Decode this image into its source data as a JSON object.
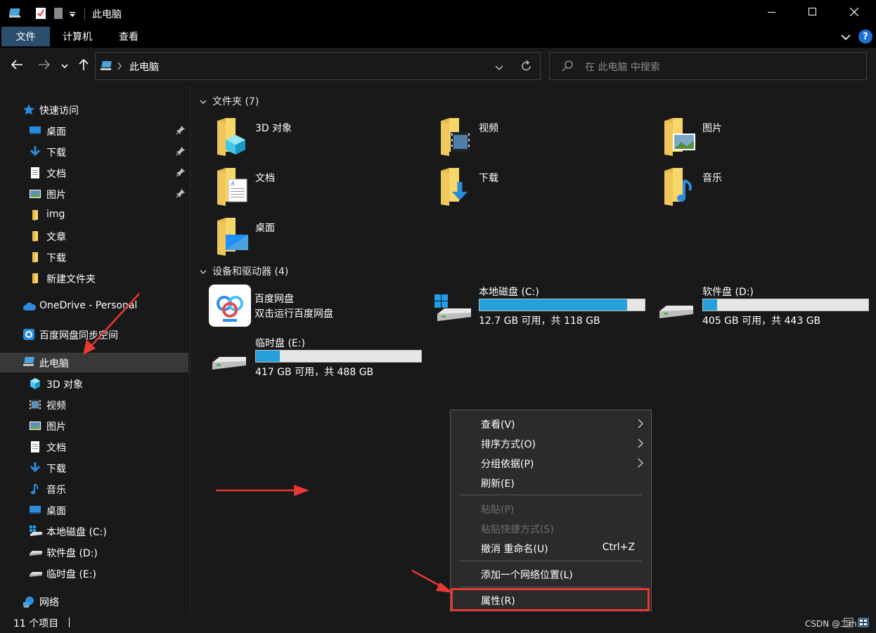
{
  "window": {
    "title": "此电脑",
    "minimize_icon": "minimize-icon",
    "maximize_icon": "maximize-icon",
    "close_icon": "close-icon"
  },
  "ribbon": {
    "tabs": [
      {
        "label": "文件",
        "active": true
      },
      {
        "label": "计算机",
        "active": false
      },
      {
        "label": "查看",
        "active": false
      }
    ],
    "help_icon": "?"
  },
  "address": {
    "path": "此电脑",
    "search_placeholder": "在 此电脑 中搜索"
  },
  "nav": {
    "quick_access": "快速访问",
    "pinned": [
      {
        "label": "桌面",
        "icon": "desktop-icon",
        "pinned": true
      },
      {
        "label": "下载",
        "icon": "download-icon",
        "pinned": true
      },
      {
        "label": "文档",
        "icon": "document-icon",
        "pinned": true
      },
      {
        "label": "图片",
        "icon": "picture-icon",
        "pinned": true
      },
      {
        "label": "img",
        "icon": "folder-icon",
        "pinned": false
      },
      {
        "label": "文章",
        "icon": "folder-icon",
        "pinned": false
      },
      {
        "label": "下载",
        "icon": "folder-icon",
        "pinned": false
      },
      {
        "label": "新建文件夹",
        "icon": "folder-icon",
        "pinned": false
      }
    ],
    "onedrive": "OneDrive - Personal",
    "baidu_sync": "百度网盘同步空间",
    "this_pc": "此电脑",
    "this_pc_children": [
      {
        "label": "3D 对象",
        "icon": "3d-objects-icon"
      },
      {
        "label": "视频",
        "icon": "video-icon"
      },
      {
        "label": "图片",
        "icon": "picture-icon"
      },
      {
        "label": "文档",
        "icon": "document-icon"
      },
      {
        "label": "下载",
        "icon": "download-icon"
      },
      {
        "label": "音乐",
        "icon": "music-icon"
      },
      {
        "label": "桌面",
        "icon": "desktop-icon"
      },
      {
        "label": "本地磁盘 (C:)",
        "icon": "windows-drive-icon"
      },
      {
        "label": "软件盘 (D:)",
        "icon": "drive-icon"
      },
      {
        "label": "临时盘 (E:)",
        "icon": "drive-icon"
      }
    ],
    "network": "网络"
  },
  "content": {
    "folders_header": "文件夹 (7)",
    "folders": [
      {
        "label": "3D 对象",
        "icon": "3d-objects-icon"
      },
      {
        "label": "视频",
        "icon": "video-icon"
      },
      {
        "label": "图片",
        "icon": "picture-icon"
      },
      {
        "label": "文档",
        "icon": "document-icon"
      },
      {
        "label": "下载",
        "icon": "download-icon"
      },
      {
        "label": "音乐",
        "icon": "music-icon"
      },
      {
        "label": "桌面",
        "icon": "desktop-icon"
      }
    ],
    "devices_header": "设备和驱动器 (4)",
    "baidu": {
      "name": "百度网盘",
      "subtitle": "双击运行百度网盘"
    },
    "drives": [
      {
        "name": "本地磁盘 (C:)",
        "free_text": "12.7 GB 可用，共 118 GB",
        "used_fraction": 0.892
      },
      {
        "name": "软件盘 (D:)",
        "free_text": "405 GB 可用，共 443 GB",
        "used_fraction": 0.086
      },
      {
        "name": "临时盘 (E:)",
        "free_text": "417 GB 可用，共 488 GB",
        "used_fraction": 0.145
      }
    ]
  },
  "context_menu": {
    "items": [
      {
        "label": "查看(V)",
        "submenu": true,
        "disabled": false
      },
      {
        "label": "排序方式(O)",
        "submenu": true,
        "disabled": false
      },
      {
        "label": "分组依据(P)",
        "submenu": true,
        "disabled": false
      },
      {
        "label": "刷新(E)",
        "submenu": false,
        "disabled": false
      },
      {
        "label": "粘贴(P)",
        "submenu": false,
        "disabled": true
      },
      {
        "label": "粘贴快捷方式(S)",
        "submenu": false,
        "disabled": true
      },
      {
        "label": "撤消 重命名(U)",
        "shortcut": "Ctrl+Z",
        "disabled": false
      },
      {
        "label": "添加一个网络位置(L)",
        "submenu": false,
        "disabled": false
      },
      {
        "label": "属性(R)",
        "submenu": false,
        "disabled": false,
        "highlighted": true
      }
    ]
  },
  "status": {
    "item_count": "11 个项目",
    "watermark": "CSDN @二m"
  },
  "colors": {
    "accent": "#26a0da",
    "annotation": "#e53935",
    "selected_nav": "#383838",
    "active_tab": "#2b4e6f"
  }
}
